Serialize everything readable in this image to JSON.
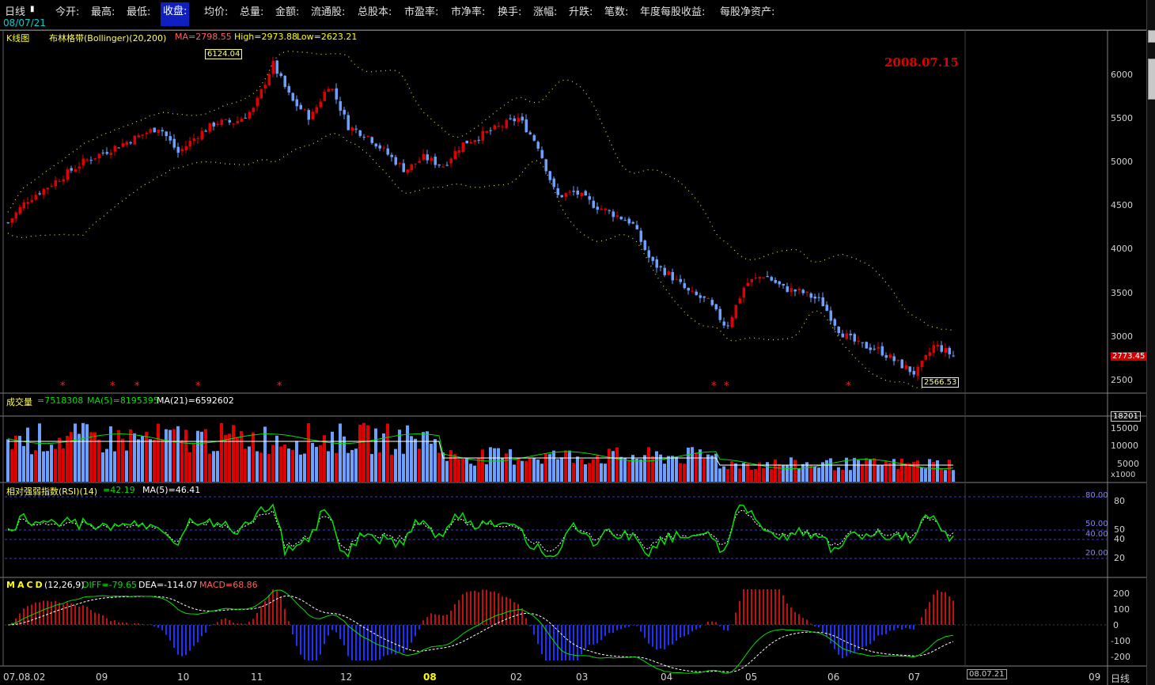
{
  "top": {
    "period": "日线",
    "fields": [
      "今开:",
      "最高:",
      "最低:",
      "收盘:",
      "均价:",
      "总量:",
      "金额:",
      "流通股:",
      "总股本:",
      "市盈率:",
      "市净率:",
      "换手:",
      "涨幅:",
      "升跌:",
      "笔数:",
      "年度每股收益:",
      "每股净资产:"
    ],
    "highlighted": "收盘:",
    "date": "08/07/21"
  },
  "kline": {
    "title": "K线图",
    "indicator": "布林格带(Bollinger)(20,200)",
    "ma": "MA=2798.55",
    "high": "High=2973.88",
    "low": "Low=2623.21",
    "annotation": "2008.07.15",
    "max_label": "6124.04",
    "min_label": "2566.53",
    "last_price": "2773.45",
    "y_ticks": [
      "6000",
      "5500",
      "5000",
      "4500",
      "4000",
      "3500",
      "3000",
      "2500"
    ]
  },
  "volume": {
    "title": "成交量",
    "v": "=7518308",
    "ma5": "MA(5)=8195395",
    "ma21": "MA(21)=6592602",
    "top_label": "18201",
    "y_ticks": [
      "15000",
      "10000",
      "5000"
    ],
    "unit": "x1000"
  },
  "rsi": {
    "title": "相对强弱指数(RSI)(14)",
    "value": "=42.19",
    "ma5": "MA(5)=46.41",
    "levels": [
      "80.00",
      "50.00",
      "40.00",
      "20.00"
    ],
    "y_ticks": [
      "80",
      "50",
      "40",
      "20"
    ]
  },
  "macd": {
    "title": "MACD",
    "params": "(12,26,9)",
    "diff": "DIFF=-79.65",
    "dea": "DEA=-114.07",
    "macd": "MACD=68.86",
    "y_ticks": [
      "200",
      "100",
      "0",
      "-100",
      "-200"
    ]
  },
  "x_axis": {
    "labels": [
      "07.08.02",
      "09",
      "10",
      "11",
      "12",
      "08",
      "02",
      "03",
      "04",
      "05",
      "06",
      "07"
    ],
    "cursor_date": "08.07.21",
    "right_labels": [
      "09",
      "日线"
    ]
  },
  "colors": {
    "up": "#e00000",
    "down": "#6aa0ff",
    "diff": "#00e000",
    "dea": "#ffffff",
    "band": "#e0e040",
    "bg": "#000000"
  },
  "chart_data": {
    "type": "candlestick",
    "series_close_approx": [
      4300,
      4560,
      4700,
      4850,
      5000,
      5100,
      5200,
      5300,
      5400,
      5100,
      5300,
      5450,
      5450,
      5600,
      6124,
      5700,
      5500,
      5900,
      5400,
      5300,
      5100,
      4900,
      5050,
      4950,
      5200,
      5300,
      5400,
      5500,
      5200,
      4600,
      4650,
      4500,
      4400,
      4300,
      3850,
      3700,
      3500,
      3400,
      3100,
      3600,
      3700,
      3550,
      3500,
      3400,
      3050,
      2900,
      2850,
      2700,
      2566,
      2900,
      2773
    ],
    "ylim": [
      2400,
      6400
    ]
  }
}
